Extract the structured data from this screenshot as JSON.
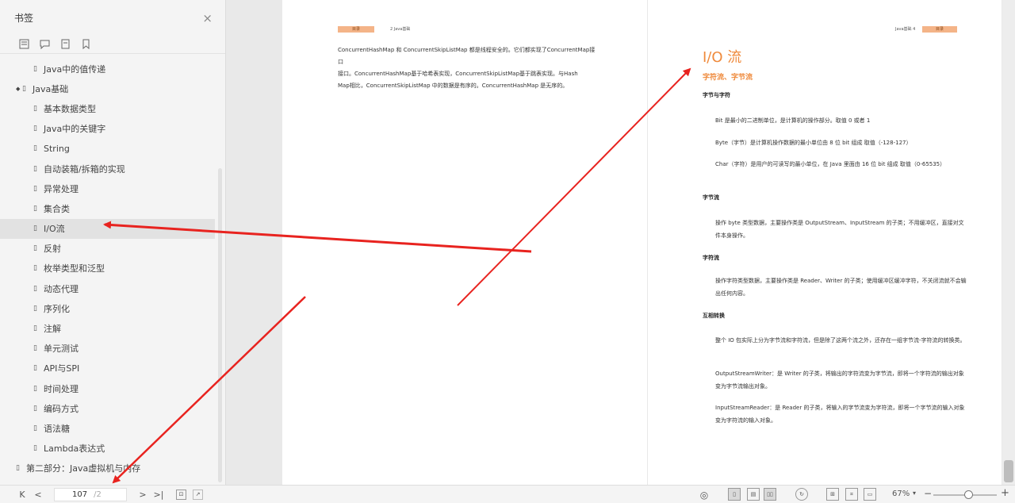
{
  "sidebar": {
    "title": "书签",
    "close": "×",
    "tools": [
      "bookmark-list-icon",
      "comment-icon",
      "thumbnail-icon",
      "bookmark-icon"
    ],
    "items": [
      {
        "label": "Java中的值传递",
        "level": 1
      },
      {
        "label": "Java基础",
        "level": 0,
        "expanded": true
      },
      {
        "label": "基本数据类型",
        "level": 1
      },
      {
        "label": "Java中的关键字",
        "level": 1
      },
      {
        "label": "String",
        "level": 1
      },
      {
        "label": "自动装箱/拆箱的实现",
        "level": 1
      },
      {
        "label": "异常处理",
        "level": 1
      },
      {
        "label": "集合类",
        "level": 1
      },
      {
        "label": "I/O流",
        "level": 1,
        "selected": true
      },
      {
        "label": "反射",
        "level": 1
      },
      {
        "label": "枚举类型和泛型",
        "level": 1
      },
      {
        "label": "动态代理",
        "level": 1
      },
      {
        "label": "序列化",
        "level": 1
      },
      {
        "label": "注解",
        "level": 1
      },
      {
        "label": "单元测试",
        "level": 1
      },
      {
        "label": "API与SPI",
        "level": 1
      },
      {
        "label": "时间处理",
        "level": 1
      },
      {
        "label": "编码方式",
        "level": 1
      },
      {
        "label": "语法糖",
        "level": 1
      },
      {
        "label": "Lambda表达式",
        "level": 1
      },
      {
        "label": "Java虚拟机与内存",
        "level": 0,
        "prefix": "第二部分："
      }
    ]
  },
  "doc": {
    "left_page": {
      "header_tag": "目录",
      "header_text": "2  Java基础",
      "paragraphs": [
        "ConcurrentHashMap 和 ConcurrentSkipListMap 都是线程安全的。它们都实现了ConcurrentMap接口",
        "接口。ConcurrentHashMap基于哈希表实现，ConcurrentSkipListMap基于跳表实现。与Hash",
        "Map相比，ConcurrentSkipListMap 中的数据是有序的。ConcurrentHashMap 是无序的。"
      ]
    },
    "right_page": {
      "header_text": "Java基础  4",
      "header_tag": "目录",
      "title": "I/O 流",
      "subtitle": "字符流、字节流",
      "sections": [
        {
          "heading": "字节与字符",
          "paras": [
            "Bit 是最小的二进制单位，是计算机的操作部分。取值 0 或者 1",
            "Byte（字节）是计算机操作数据的最小单位由 8 位 bit 组成 取值（-128-127）",
            "Char（字符）是用户的可读写的最小单位，在 Java 里面由 16 位 bit 组成 取值（0-65535）"
          ]
        },
        {
          "heading": "字节流",
          "paras": [
            "操作 byte 类型数据，主要操作类是 OutputStream、InputStream 的子类；不用缓冲区，直接对文件本身操作。"
          ]
        },
        {
          "heading": "字符流",
          "paras": [
            "操作字符类型数据，主要操作类是 Reader、Writer 的子类；使用缓冲区缓冲字符，不关闭流就不会输出任何内容。"
          ]
        },
        {
          "heading": "互相转换",
          "paras": [
            "整个 IO 包实际上分为字节流和字符流，但是除了这两个流之外，还存在一组字节流-字符流的转换类。",
            "OutputStreamWriter：是 Writer 的子类，将输出的字符流变为字节流，即将一个字符流的输出对象变为字节流输出对象。",
            "InputStreamReader：是 Reader 的子类，将输入的字节流变为字符流，即将一个字节流的输入对象变为字符流的输入对象。"
          ]
        }
      ]
    }
  },
  "bottombar": {
    "first": "K",
    "prev": "<",
    "page_current": "107",
    "page_total": "/2",
    "next": ">",
    "last": ">|",
    "zoom": "67%",
    "zoom_minus": "−",
    "zoom_plus": "+",
    "zoom_level": 0.55
  },
  "colors": {
    "accent": "#ef8a3c",
    "arrow": "#e8231f"
  }
}
